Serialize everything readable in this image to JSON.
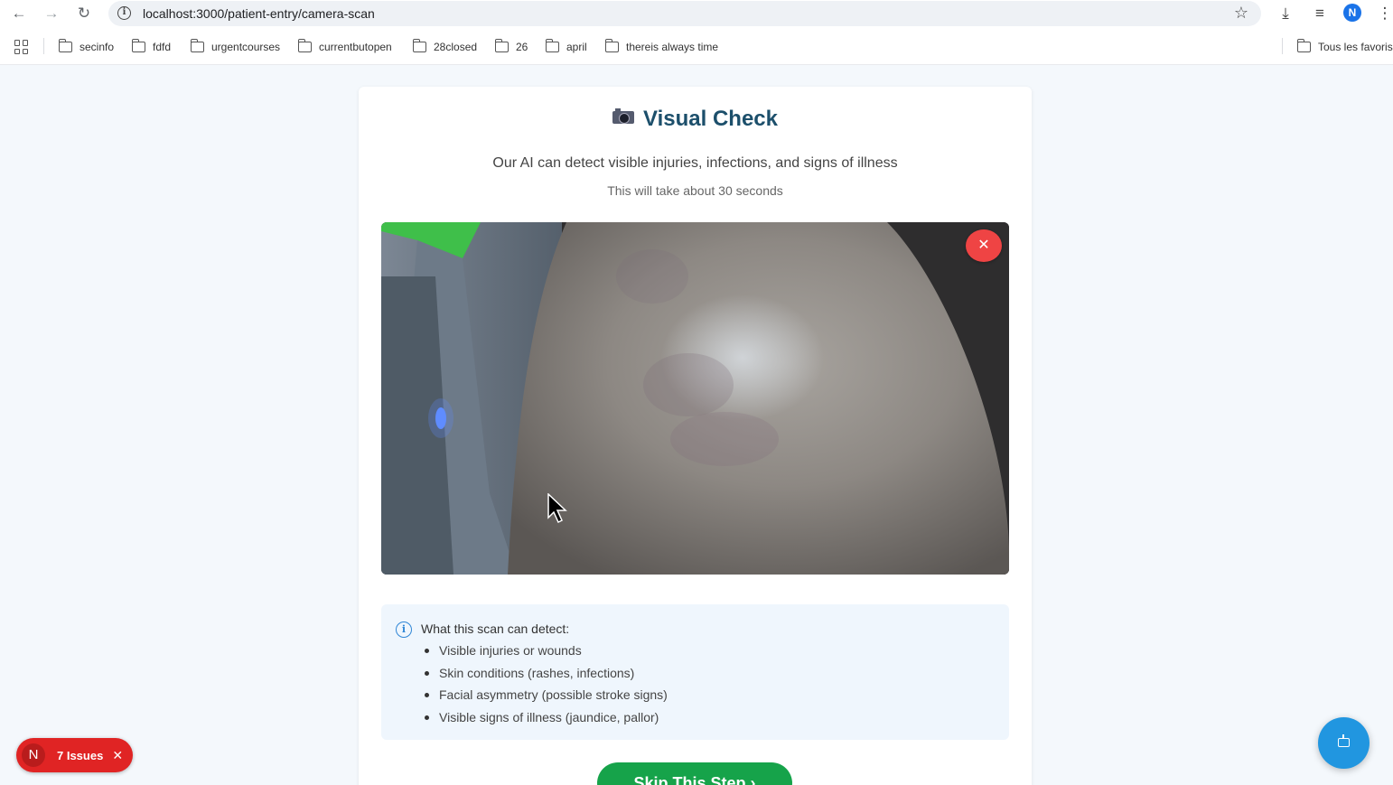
{
  "browser": {
    "url": "localhost:3000/patient-entry/camera-scan",
    "profile_initial": "N",
    "bookmarks": [
      "secinfo",
      "fdfd",
      "urgentcourses",
      "currentbutopen",
      "28closed",
      "26",
      "april",
      "thereis always time"
    ],
    "all_bookmarks_label": "Tous les favoris"
  },
  "card": {
    "title": "Visual Check",
    "subtitle": "Our AI can detect visible injuries, infections, and signs of illness",
    "duration": "This will take about 30 seconds",
    "close_camera_label": "✕"
  },
  "info": {
    "heading": "What this scan can detect:",
    "items": [
      "Visible injuries or wounds",
      "Skin conditions (rashes, infections)",
      "Facial asymmetry (possible stroke signs)",
      "Visible signs of illness (jaundice, pallor)"
    ]
  },
  "actions": {
    "skip_label": "Skip This Step  ›"
  },
  "overlay": {
    "issues_initial": "N",
    "issues_label": "7 Issues",
    "issues_close": "✕"
  },
  "colors": {
    "accent": "#2196e0",
    "danger": "#ef4444",
    "success": "#16a34a",
    "title": "#1c4f6b"
  }
}
